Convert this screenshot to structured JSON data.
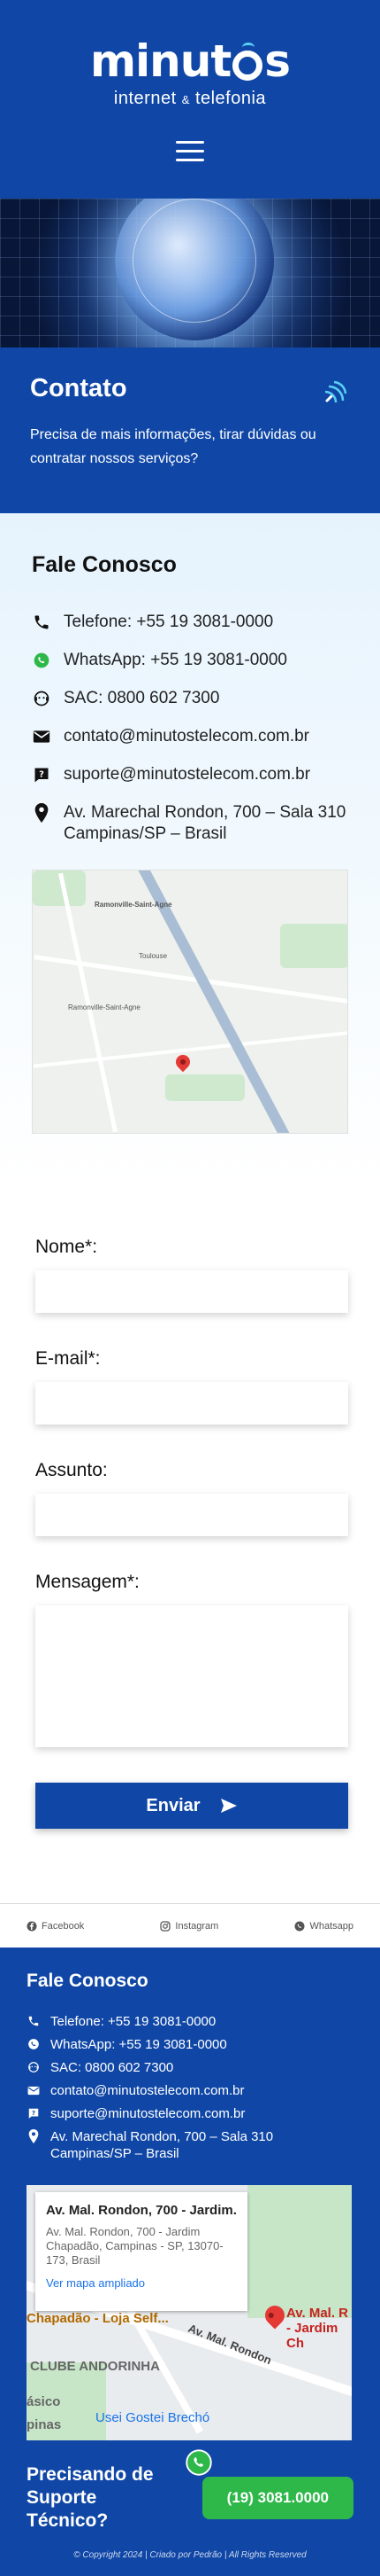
{
  "header": {
    "logo_text_before": "minut",
    "logo_text_after": "s",
    "logo_sub_a": "internet",
    "logo_sub_amp": "&",
    "logo_sub_b": "telefonia",
    "menu_icon": "hamburger-icon"
  },
  "hero": {
    "alt": "globe-network-image"
  },
  "contato": {
    "title": "Contato",
    "description": "Precisa de mais informações, tirar dúvidas ou contratar nossos serviços?"
  },
  "fale_conosco": {
    "title": "Fale Conosco",
    "items": [
      {
        "icon": "phone-icon",
        "text": "Telefone: +55 19 3081-0000"
      },
      {
        "icon": "whatsapp-icon",
        "text": "WhatsApp: +55 19 3081-0000"
      },
      {
        "icon": "support-agent-icon",
        "text": "SAC: 0800 602 7300"
      },
      {
        "icon": "email-icon",
        "text": "contato@minutostelecom.com.br"
      },
      {
        "icon": "help-icon",
        "text": "suporte@minutostelecom.com.br"
      },
      {
        "icon": "location-icon",
        "text": "Av. Marechal Rondon, 700 – Sala 310 Campinas/SP – Brasil"
      }
    ],
    "map_labels": [
      "Ramonville-Saint-Agne",
      "Toulouse",
      "Ramonville-Saint-Agne"
    ]
  },
  "form": {
    "name_label": "Nome*:",
    "email_label": "E-mail*:",
    "subject_label": "Assunto:",
    "message_label": "Mensagem*:",
    "submit_label": "Enviar"
  },
  "social": [
    {
      "icon": "facebook-icon",
      "label": "Facebook"
    },
    {
      "icon": "instagram-icon",
      "label": "Instagram"
    },
    {
      "icon": "whatsapp-icon",
      "label": "Whatsapp"
    }
  ],
  "footer": {
    "title": "Fale Conosco",
    "items": [
      {
        "icon": "phone-icon",
        "text": "Telefone: +55 19 3081-0000"
      },
      {
        "icon": "whatsapp-icon",
        "text": "WhatsApp: +55 19 3081-0000"
      },
      {
        "icon": "support-agent-icon",
        "text": "SAC: 0800 602 7300"
      },
      {
        "icon": "email-icon",
        "text": "contato@minutostelecom.com.br"
      },
      {
        "icon": "help-icon",
        "text": "suporte@minutostelecom.com.br"
      },
      {
        "icon": "location-icon",
        "text": "Av. Marechal Rondon, 700 – Sala 310 Campinas/SP – Brasil"
      }
    ],
    "map": {
      "card_title": "Av. Mal. Rondon, 700 - Jardim...",
      "card_address": "Av. Mal. Rondon, 700 - Jardim Chapadão, Campinas - SP, 13070-173, Brasil",
      "card_link": "Ver mapa ampliado",
      "label_chapadao": "Chapadão - Loja Self...",
      "label_clube": "CLUBE ANDORINHA",
      "label_street": "Av. Mal. Rondon",
      "label_pin": "Av. Mal. R - Jardim Ch",
      "label_brecho": "Usei Gostei Brechó",
      "label_basico": "ásico",
      "label_pinas": "pinas"
    },
    "cta_question": "Precisando de Suporte Técnico?",
    "cta_button": "(19) 3081.0000",
    "copyright": "© Copyright 2024 | Criado por Pedrão | All Rights Reserved"
  },
  "colors": {
    "brand_blue": "#1047a6",
    "whatsapp_green": "#2eb84a",
    "accent_cyan": "#5ad0f5"
  }
}
